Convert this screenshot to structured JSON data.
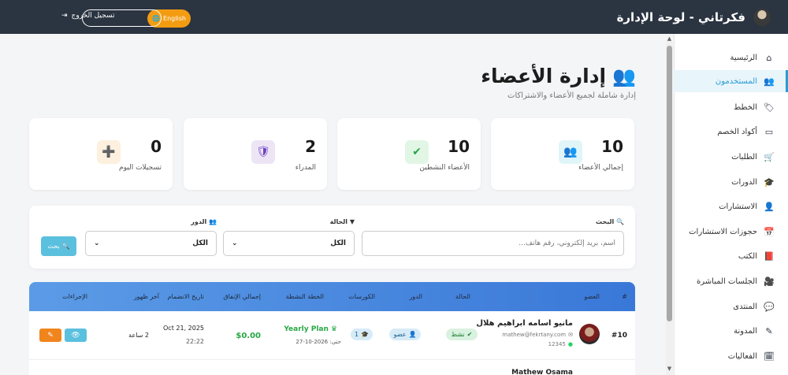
{
  "header": {
    "title": "فكرتاني - لوحة الإدارة",
    "language_button": "English",
    "logout_label": "تسجيل الخروج"
  },
  "sidebar": {
    "items": [
      {
        "label": "الرئيسية",
        "icon": "home-icon",
        "active": false
      },
      {
        "label": "المستخدمون",
        "icon": "users-icon",
        "active": true
      },
      {
        "label": "الخطط",
        "icon": "tags-icon",
        "active": false
      },
      {
        "label": "أكواد الخصم",
        "icon": "ticket-icon",
        "active": false
      },
      {
        "label": "الطلبات",
        "icon": "cart-icon",
        "active": false
      },
      {
        "label": "الدورات",
        "icon": "graduation-cap-icon",
        "active": false
      },
      {
        "label": "الاستشارات",
        "icon": "consultant-icon",
        "active": false
      },
      {
        "label": "حجوزات الاستشارات",
        "icon": "calendar-check-icon",
        "active": false
      },
      {
        "label": "الكتب",
        "icon": "book-icon",
        "active": false
      },
      {
        "label": "الجلسات المباشرة",
        "icon": "video-icon",
        "active": false
      },
      {
        "label": "المنتدى",
        "icon": "comments-icon",
        "active": false
      },
      {
        "label": "المدونة",
        "icon": "blog-icon",
        "active": false
      },
      {
        "label": "الفعاليات",
        "icon": "calendar-icon",
        "active": false
      }
    ]
  },
  "page": {
    "title": "إدارة الأعضاء",
    "subtitle": "إدارة شاملة لجميع الأعضاء والاشتراكات"
  },
  "stats": [
    {
      "value": "10",
      "label": "إجمالي الأعضاء",
      "icon": "users-icon",
      "color": "#17a2b8"
    },
    {
      "value": "10",
      "label": "الأعضاء النشطين",
      "icon": "user-check-icon",
      "color": "#28a745"
    },
    {
      "value": "2",
      "label": "المدراء",
      "icon": "user-shield-icon",
      "color": "#6f42c1"
    },
    {
      "value": "0",
      "label": "تسجيلات اليوم",
      "icon": "user-plus-icon",
      "color": "#f39c12"
    }
  ],
  "filters": {
    "search_label": "البحث",
    "search_placeholder": "اسم، بريد إلكتروني، رقم هاتف...",
    "status_label": "الحالة",
    "status_value": "الكل",
    "role_label": "الدور",
    "role_value": "الكل",
    "search_button": "بحث"
  },
  "table": {
    "columns": [
      "#",
      "العضو",
      "الحالة",
      "الدور",
      "الكورسات",
      "الخطة النشطة",
      "إجمالي الإنفاق",
      "تاريخ الانضمام",
      "آخر ظهور",
      "الإجراءات"
    ],
    "rows": [
      {
        "id": "#10",
        "name": "مانيو اسامه ابراهيم هلال",
        "email": "mathew@fekrtany.com",
        "phone": "12345",
        "status": "نشط",
        "role": "عضو",
        "courses": "1",
        "plan": "Yearly Plan",
        "plan_until": "حتى: 2026-10-27",
        "spent": "$0.00",
        "joined_date": "Oct 21, 2025",
        "joined_time": "22:22",
        "last_seen": "2 ساعة"
      }
    ],
    "next_row_name": "Mathew Osama"
  }
}
